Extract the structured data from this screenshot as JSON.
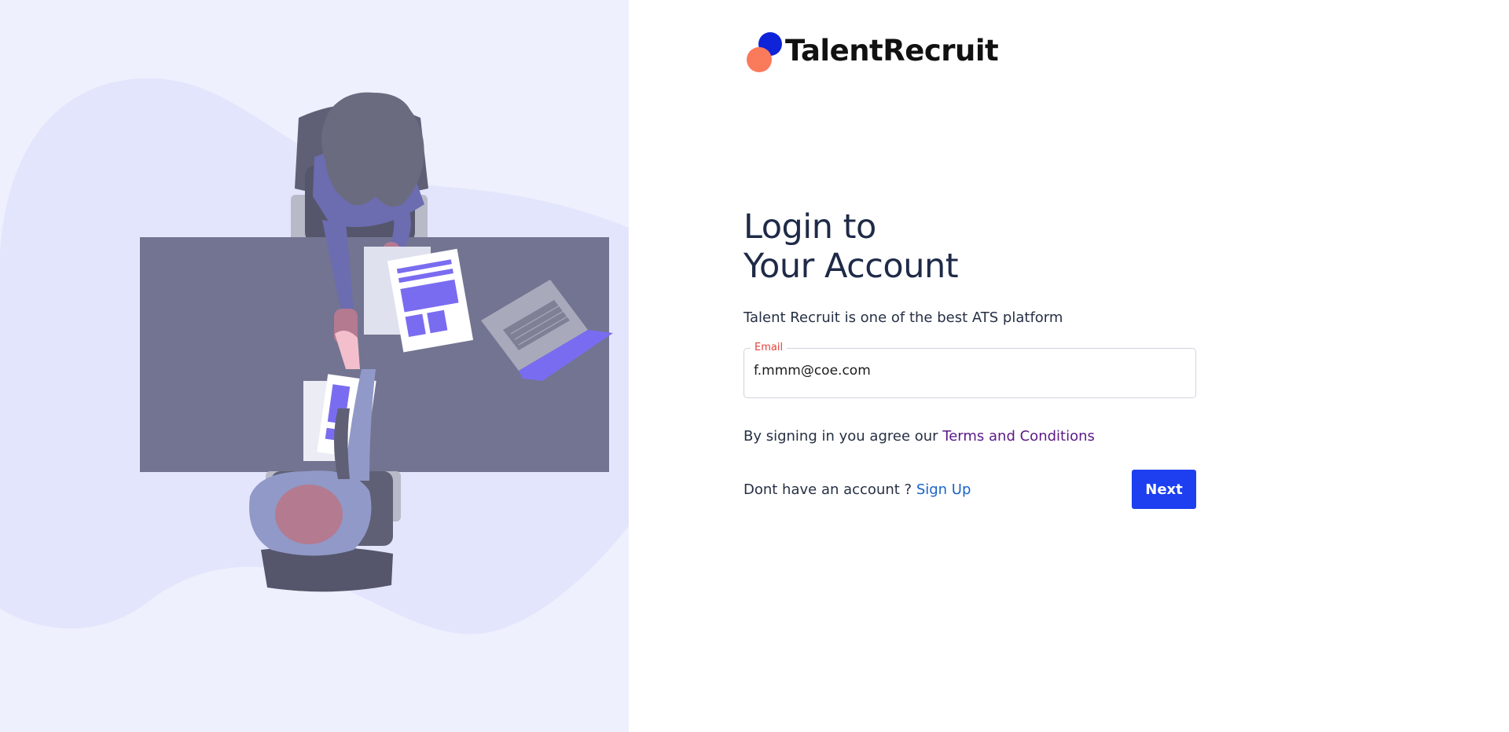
{
  "brand": {
    "name": "TalentRecruit",
    "colors": {
      "mark_primary": "#0f23d9",
      "mark_secondary": "#fa7a5c",
      "button": "#1d3ff0"
    }
  },
  "illustration": {
    "icon": "handshake-illustration"
  },
  "login": {
    "title_line1": "Login to",
    "title_line2": "Your Account",
    "subtitle": "Talent Recruit is one of the best ATS platform",
    "email_label": "Email",
    "email_value": "f.mmm@coe.com",
    "terms_prefix": "By signing in you agree our ",
    "terms_link": "Terms and Conditions",
    "signup_prefix": "Dont have an account ? ",
    "signup_link": "Sign Up",
    "next_label": "Next"
  }
}
